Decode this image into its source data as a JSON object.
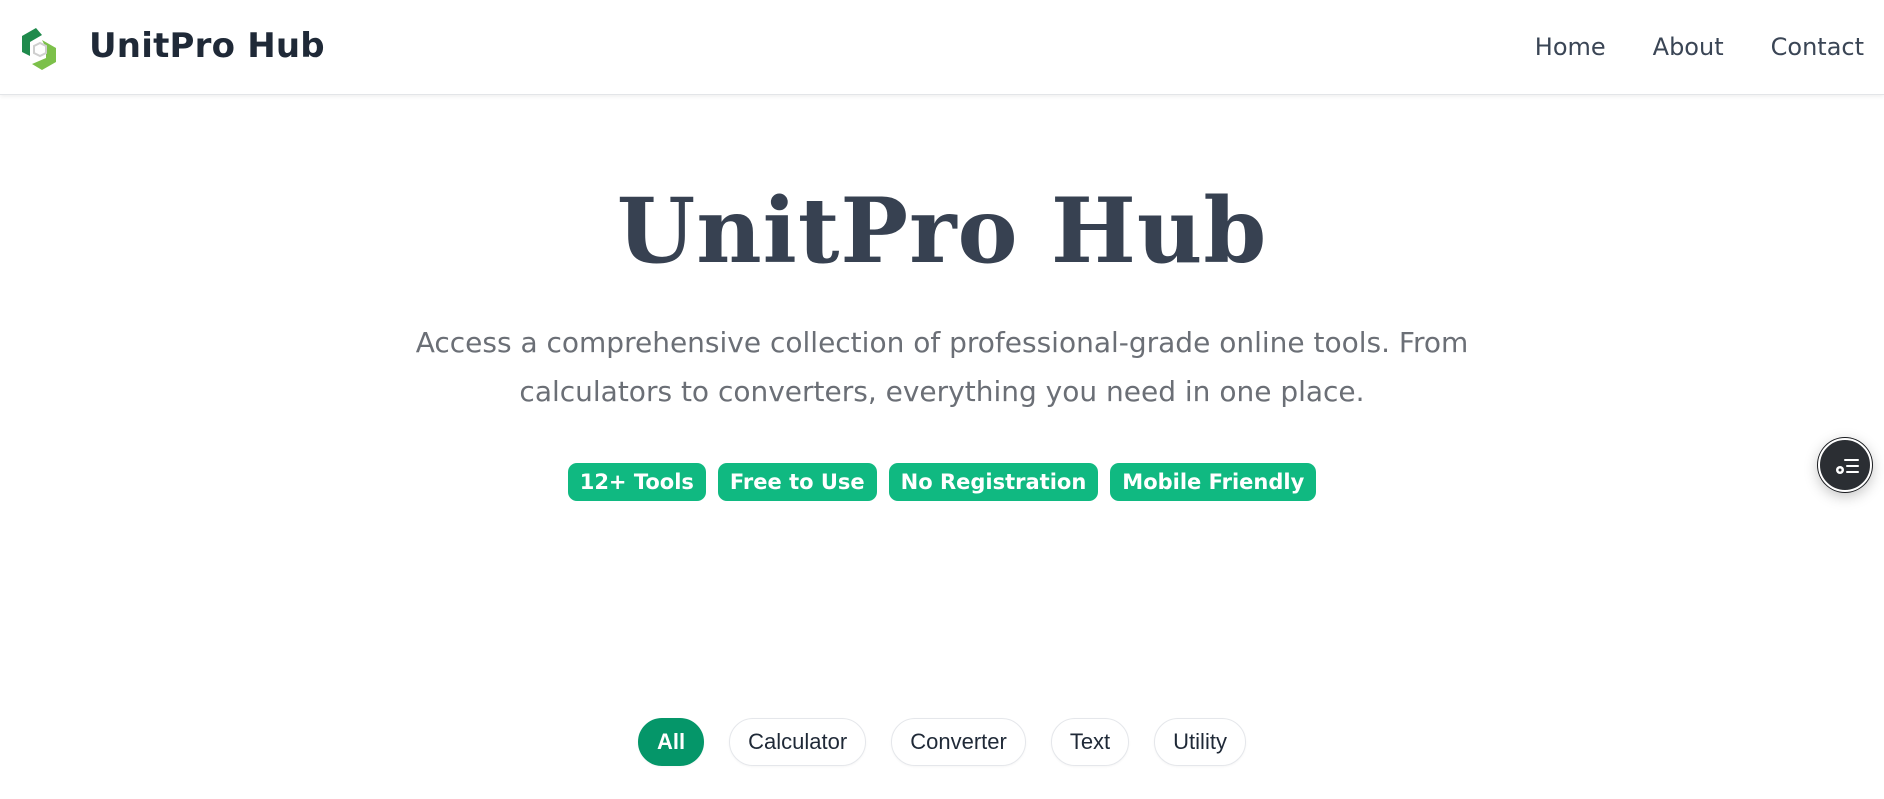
{
  "header": {
    "brand": "UnitPro Hub",
    "logo_icon": "hexagon-logo-icon",
    "nav": [
      {
        "label": "Home"
      },
      {
        "label": "About"
      },
      {
        "label": "Contact"
      }
    ]
  },
  "hero": {
    "title": "UnitPro Hub",
    "subtitle": "Access a comprehensive collection of professional-grade online tools. From calculators to converters, everything you need in one place.",
    "badges": [
      "12+ Tools",
      "Free to Use",
      "No Registration",
      "Mobile Friendly"
    ]
  },
  "filters": {
    "items": [
      "All",
      "Calculator",
      "Converter",
      "Text",
      "Utility"
    ],
    "selected": "All"
  },
  "floating_button": {
    "icon": "settings-list-icon"
  },
  "colors": {
    "accent": "#10b981",
    "accent_dark": "#059669",
    "text_dark": "#1f2937",
    "text_muted": "#6b6f76"
  }
}
